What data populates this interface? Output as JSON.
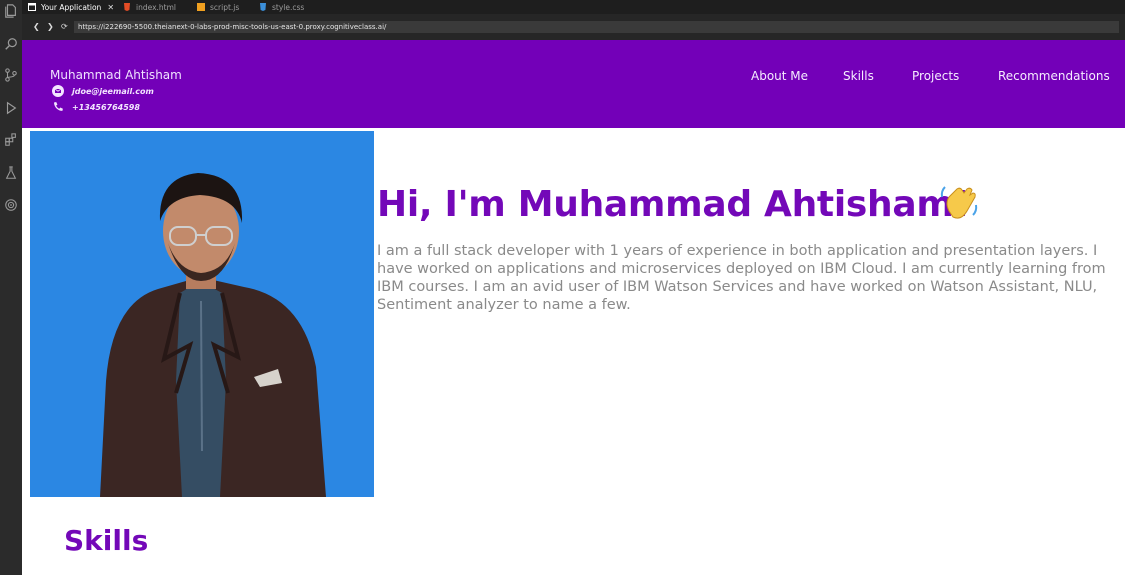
{
  "ide": {
    "activity_icons": [
      "files-icon",
      "search-icon",
      "source-control-icon",
      "run-debug-icon",
      "extensions-icon",
      "testing-icon",
      "remote-icon"
    ]
  },
  "tabs": [
    {
      "label": "Your Application",
      "icon": "browser-icon",
      "active": true
    },
    {
      "label": "index.html",
      "icon": "html-file-icon",
      "active": false
    },
    {
      "label": "script.js",
      "icon": "js-file-icon",
      "active": false
    },
    {
      "label": "style.css",
      "icon": "css-file-icon",
      "active": false
    }
  ],
  "browser": {
    "url": "https://i222690-5500.theianext-0-labs-prod-misc-tools-us-east-0.proxy.cognitiveclass.ai/"
  },
  "header": {
    "name": "Muhammad Ahtisham",
    "email": "jdoe@jeemail.com",
    "phone": "+13456764598",
    "nav": [
      "About Me",
      "Skills",
      "Projects",
      "Recommendations"
    ]
  },
  "hero": {
    "title": "Hi, I'm Muhammad Ahtisham!",
    "emoji": "waving-hand-icon",
    "bio": "I am a full stack developer with 1 years of experience in both application and presentation layers. I have worked on applications and microservices deployed on IBM Cloud. I am currently learning from IBM courses. I am an avid user of IBM Watson Services and have worked on Watson Assistant, NLU, Sentiment analyzer to name a few."
  },
  "sections": {
    "skills_title": "Skills"
  },
  "colors": {
    "header_bg": "#7300b8",
    "accent": "#7308b8",
    "photo_bg": "#2b87e3",
    "ide_bg": "#1e1e1e"
  }
}
